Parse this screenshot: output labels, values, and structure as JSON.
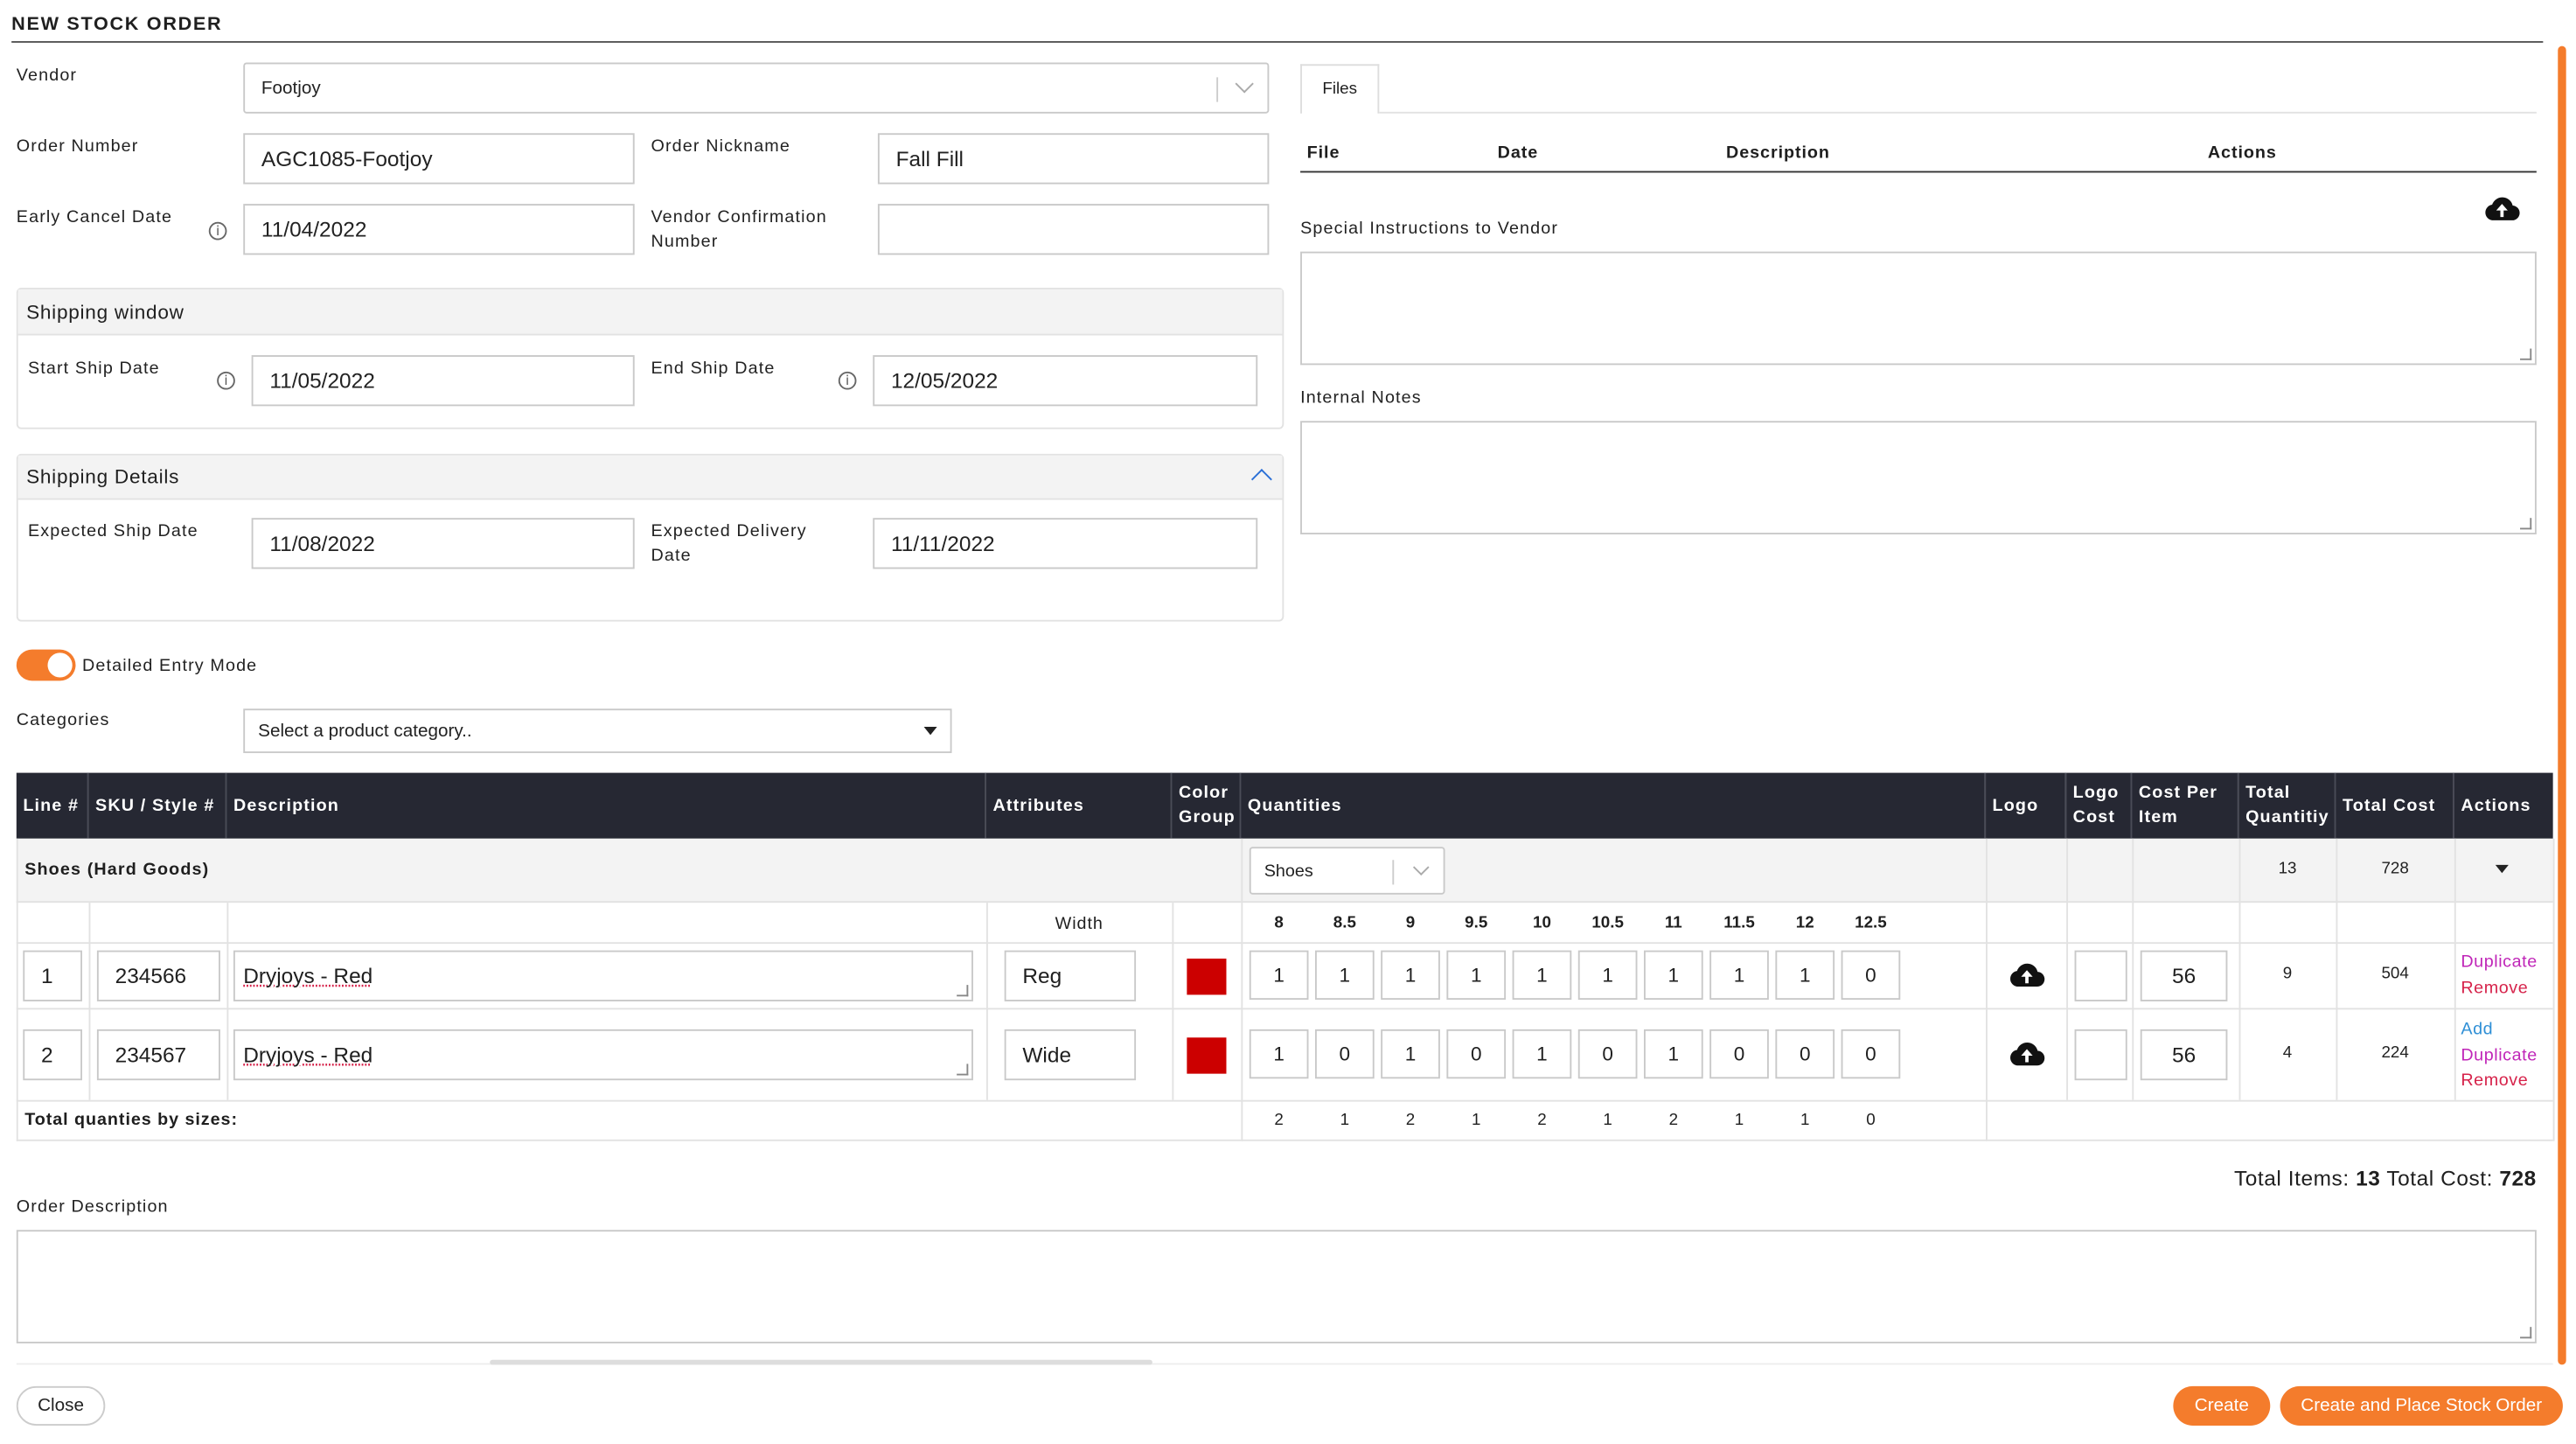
{
  "title": "NEW STOCK ORDER",
  "vendor": {
    "label": "Vendor",
    "value": "Footjoy"
  },
  "order_number": {
    "label": "Order Number",
    "value": "AGC1085-Footjoy"
  },
  "order_nickname": {
    "label": "Order Nickname",
    "value": "Fall Fill"
  },
  "early_cancel": {
    "label": "Early Cancel Date",
    "value": "11/04/2022"
  },
  "vendor_conf": {
    "label_line1": "Vendor Confirmation",
    "label_line2": "Number",
    "value": ""
  },
  "shipping_window": {
    "title": "Shipping window",
    "start_label": "Start Ship Date",
    "start_value": "11/05/2022",
    "end_label": "End Ship Date",
    "end_value": "12/05/2022"
  },
  "shipping_details": {
    "title": "Shipping Details",
    "expected_ship_label": "Expected Ship Date",
    "expected_ship_value": "11/08/2022",
    "expected_delivery_label_line1": "Expected Delivery",
    "expected_delivery_label_line2": "Date",
    "expected_delivery_value": "11/11/2022"
  },
  "files": {
    "tab": "Files",
    "columns": [
      "File",
      "Date",
      "Description",
      "Actions"
    ]
  },
  "special_instructions": {
    "label": "Special Instructions to Vendor",
    "value": ""
  },
  "internal_notes": {
    "label": "Internal Notes",
    "value": ""
  },
  "detailed_entry": {
    "label": "Detailed Entry Mode",
    "on": true
  },
  "categories": {
    "label": "Categories",
    "placeholder": "Select a product category.."
  },
  "table": {
    "headers": {
      "line": "Line #",
      "sku": "SKU / Style #",
      "description": "Description",
      "attributes": "Attributes",
      "color_group_1": "Color",
      "color_group_2": "Group",
      "quantities": "Quantities",
      "logo": "Logo",
      "logo_cost_1": "Logo",
      "logo_cost_2": "Cost",
      "cost_per_item_1": "Cost Per",
      "cost_per_item_2": "Item",
      "total_qty_1": "Total",
      "total_qty_2": "Quantitiy",
      "total_cost": "Total Cost",
      "actions": "Actions"
    },
    "group": {
      "name": "Shoes (Hard Goods)",
      "select": "Shoes",
      "total_qty": "13",
      "total_cost": "728"
    },
    "attribute_header": "Width",
    "sizes": [
      "8",
      "8.5",
      "9",
      "9.5",
      "10",
      "10.5",
      "11",
      "11.5",
      "12",
      "12.5"
    ],
    "rows": [
      {
        "line": "1",
        "sku": "234566",
        "description": "Dryjoys - Red",
        "width": "Reg",
        "color": "#cc0000",
        "qty": [
          "1",
          "1",
          "1",
          "1",
          "1",
          "1",
          "1",
          "1",
          "1",
          "0"
        ],
        "logo_cost": "",
        "cost": "56",
        "total_qty": "9",
        "total_cost": "504",
        "actions": [
          "Duplicate",
          "Remove"
        ]
      },
      {
        "line": "2",
        "sku": "234567",
        "description": "Dryjoys - Red",
        "width": "Wide",
        "color": "#cc0000",
        "qty": [
          "1",
          "0",
          "1",
          "0",
          "1",
          "0",
          "1",
          "0",
          "0",
          "0"
        ],
        "logo_cost": "",
        "cost": "56",
        "total_qty": "4",
        "total_cost": "224",
        "actions": [
          "Add",
          "Duplicate",
          "Remove"
        ]
      }
    ],
    "totals_label": "Total quanties by sizes:",
    "totals": [
      "2",
      "1",
      "2",
      "1",
      "2",
      "1",
      "2",
      "1",
      "1",
      "0"
    ]
  },
  "summary": {
    "items_label": "Total Items:",
    "items_value": "13",
    "cost_label": "Total Cost:",
    "cost_value": "728"
  },
  "order_description": {
    "label": "Order Description",
    "value": ""
  },
  "buttons": {
    "close": "Close",
    "create": "Create",
    "create_place": "Create and Place Stock Order"
  },
  "colors": {
    "accent": "#f47c2c",
    "header_dark": "#262833",
    "swatch": "#cc0000",
    "link_magenta": "#c026b8",
    "link_red": "#d6224a",
    "link_blue": "#2f8fd6"
  }
}
